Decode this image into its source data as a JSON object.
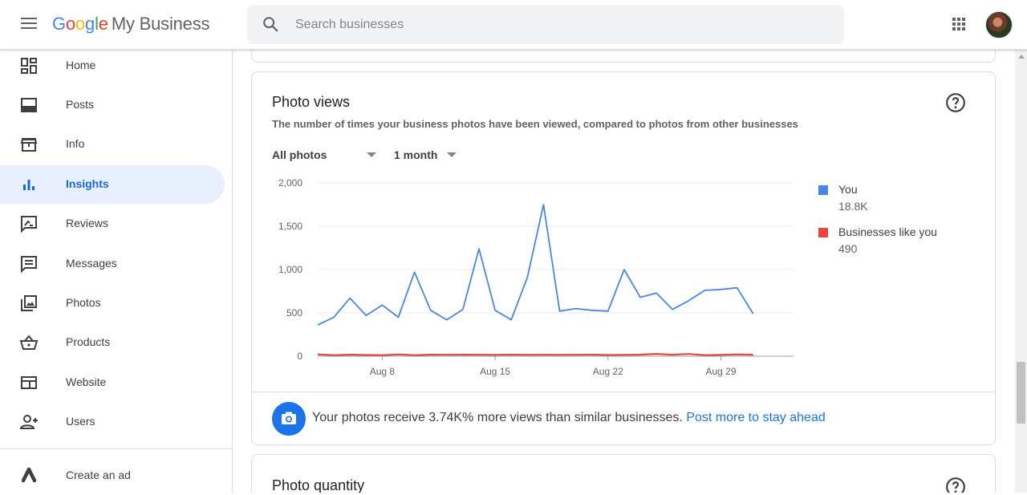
{
  "header": {
    "logo_google": [
      "G",
      "o",
      "o",
      "g",
      "l",
      "e"
    ],
    "logo_product": "My Business",
    "search_placeholder": "Search businesses"
  },
  "sidebar": {
    "items": [
      {
        "label": "Home",
        "icon": "dashboard-icon"
      },
      {
        "label": "Posts",
        "icon": "posts-icon"
      },
      {
        "label": "Info",
        "icon": "store-icon"
      },
      {
        "label": "Insights",
        "icon": "insights-icon",
        "active": true
      },
      {
        "label": "Reviews",
        "icon": "reviews-icon"
      },
      {
        "label": "Messages",
        "icon": "messages-icon"
      },
      {
        "label": "Photos",
        "icon": "photos-icon"
      },
      {
        "label": "Products",
        "icon": "basket-icon"
      },
      {
        "label": "Website",
        "icon": "website-icon"
      },
      {
        "label": "Users",
        "icon": "add-user-icon"
      },
      {
        "label": "Create an ad",
        "icon": "google-ads-icon"
      }
    ]
  },
  "card": {
    "title": "Photo views",
    "subtitle": "The number of times your business photos have been viewed, compared to photos from other businesses",
    "filter_photos": "All photos",
    "filter_period": "1 month",
    "footer_text": "Your photos receive 3.74K% more views than similar businesses.",
    "footer_link": "Post more to stay ahead"
  },
  "card2": {
    "title": "Photo quantity"
  },
  "legend": [
    {
      "name": "You",
      "value": "18.8K",
      "color": "#4a86e8"
    },
    {
      "name": "Businesses like you",
      "value": "490",
      "color": "#e8453c"
    }
  ],
  "chart_data": {
    "type": "line",
    "x": [
      "Aug 4",
      "Aug 5",
      "Aug 6",
      "Aug 7",
      "Aug 8",
      "Aug 9",
      "Aug 10",
      "Aug 11",
      "Aug 12",
      "Aug 13",
      "Aug 14",
      "Aug 15",
      "Aug 16",
      "Aug 17",
      "Aug 18",
      "Aug 19",
      "Aug 20",
      "Aug 21",
      "Aug 22",
      "Aug 23",
      "Aug 24",
      "Aug 25",
      "Aug 26",
      "Aug 27",
      "Aug 28",
      "Aug 29",
      "Aug 30",
      "Aug 31",
      "Sep 1"
    ],
    "xticks": [
      "Aug 8",
      "Aug 15",
      "Aug 22",
      "Aug 29"
    ],
    "yticks": [
      "0",
      "500",
      "1,000",
      "1,500",
      "2,000"
    ],
    "ylim": [
      0,
      2000
    ],
    "series": [
      {
        "name": "You",
        "color": "#4a86e8",
        "values": [
          360,
          450,
          670,
          470,
          590,
          450,
          970,
          530,
          420,
          540,
          1240,
          530,
          420,
          910,
          1750,
          520,
          550,
          530,
          520,
          1000,
          680,
          730,
          540,
          640,
          760,
          770,
          790,
          490
        ]
      },
      {
        "name": "Businesses like you",
        "color": "#e8453c",
        "values": [
          20,
          12,
          18,
          14,
          12,
          20,
          12,
          18,
          17,
          18,
          17,
          16,
          18,
          16,
          17,
          16,
          17,
          18,
          14,
          16,
          18,
          27,
          17,
          26,
          12,
          16,
          20,
          18
        ]
      }
    ],
    "grid": true
  }
}
